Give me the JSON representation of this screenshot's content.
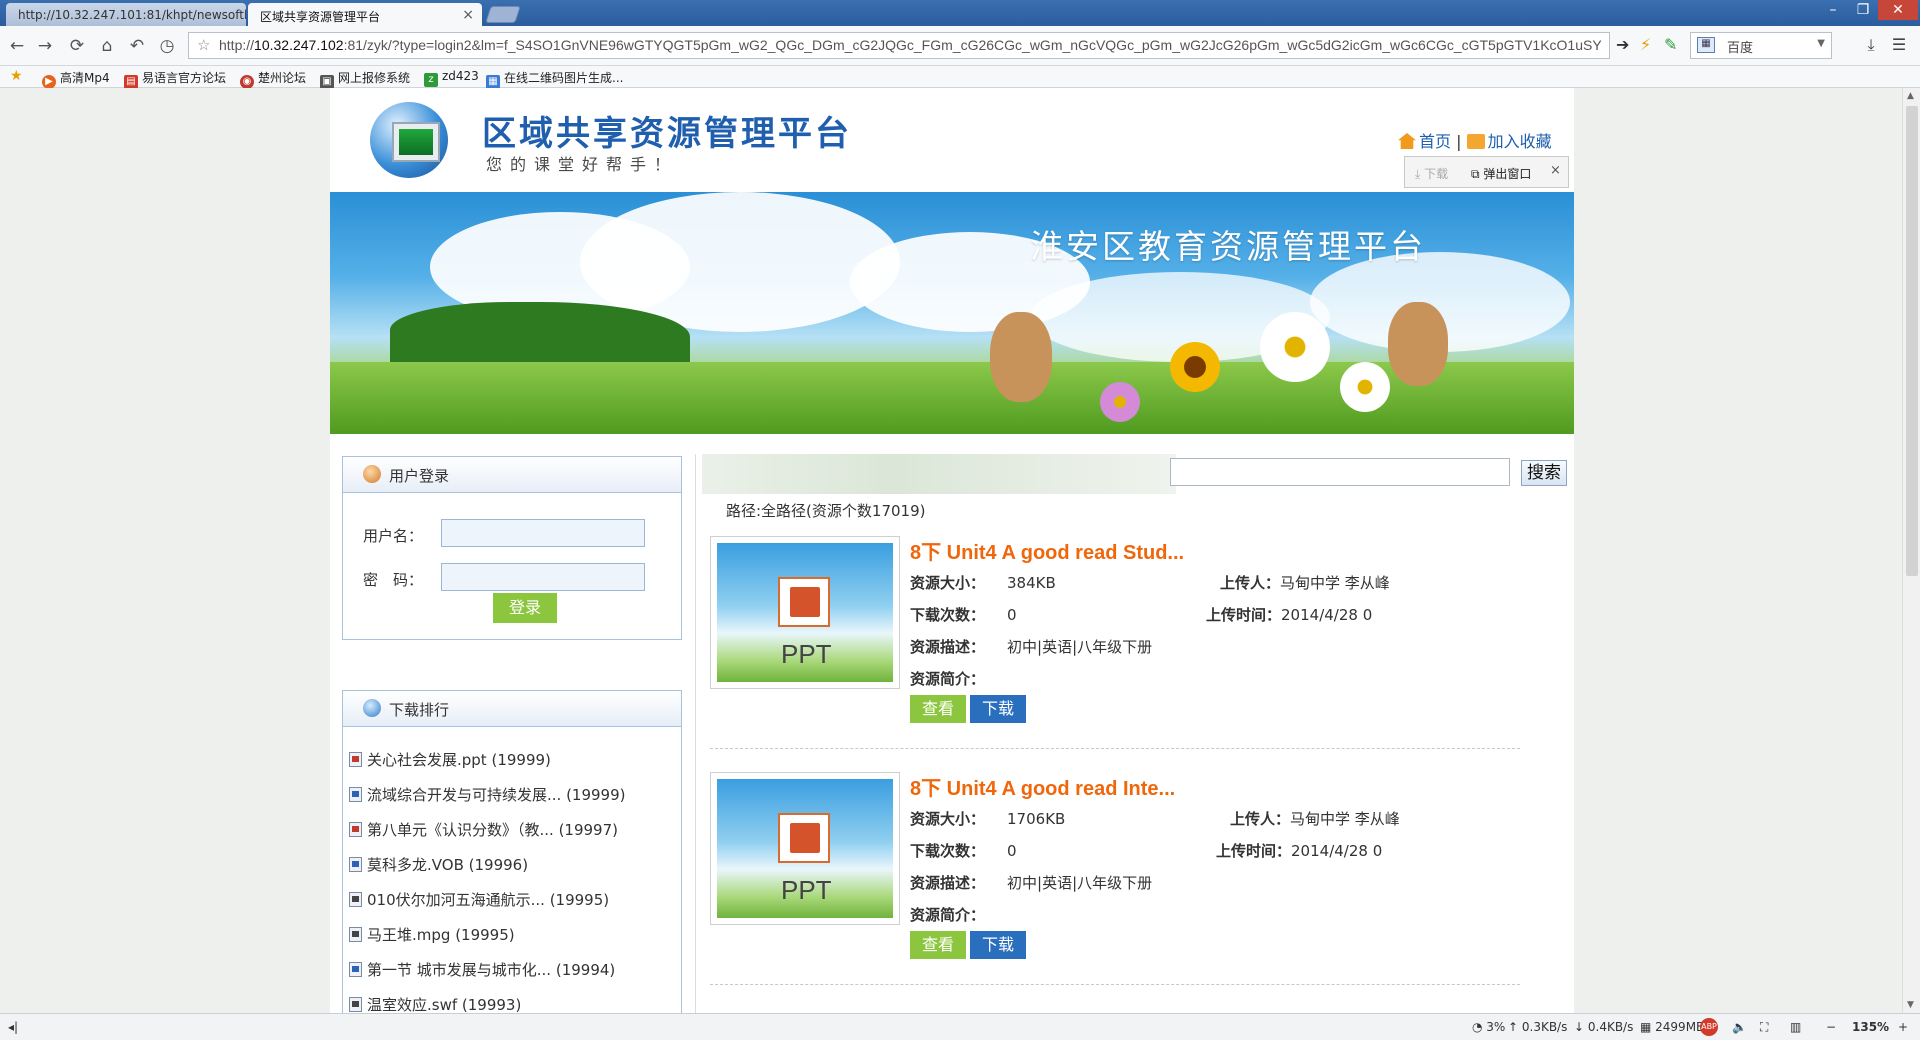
{
  "browser": {
    "tabs": [
      {
        "title": "http://10.32.247.101:81/khpt/newsoftli..."
      },
      {
        "title": "区域共享资源管理平台"
      }
    ],
    "address_prefix": "http://",
    "address_host": "10.32.247.102",
    "address_rest": ":81/zyk/?type=login2&lm=f_S4SO1GnVNE96wGTYQGT5pGm_wG2_QGc_DGm_cG2JQGc_FGm_cG26CGc_wGm_nGcVQGc_pGm_wG2JcG26pGm_wGc5dG2icGm_wGc6CGc_cGT5pGTV1KcO1uSY",
    "search_engine": "百度",
    "bookmarks": [
      "高清Mp4",
      "易语言官方论坛",
      "楚州论坛",
      "网上报修系统",
      "zd423",
      "在线二维码图片生成..."
    ],
    "status": {
      "cpu": "3%",
      "upload": "0.3KB/s",
      "download": "0.4KB/s",
      "memory": "2499MB",
      "zoom": "135%"
    }
  },
  "header": {
    "title": "区域共享资源管理平台",
    "slogan": "您的课堂好帮手！",
    "home_link": "首页",
    "separator": "|",
    "favorite_link": "加入收藏",
    "float_download": "下载",
    "float_popup": "弹出窗口",
    "float_close": "×"
  },
  "banner": {
    "title": "淮安区教育资源管理平台"
  },
  "login": {
    "heading": "用户登录",
    "username_label": "用户名：",
    "password_label": "密　码：",
    "submit": "登录"
  },
  "ranking": {
    "heading": "下载排行",
    "items": [
      {
        "name": "关心社会发展.ppt (19999)",
        "kind": "ppt"
      },
      {
        "name": "流域综合开发与可持续发展... (19999)",
        "kind": "doc"
      },
      {
        "name": "第八单元《认识分数》（教... (19997)",
        "kind": "ppt"
      },
      {
        "name": "莫科多龙.VOB (19996)",
        "kind": "doc"
      },
      {
        "name": "010伏尔加河五海通航示... (19995)",
        "kind": "swf"
      },
      {
        "name": "马王堆.mpg (19995)",
        "kind": "vid"
      },
      {
        "name": "第一节 城市发展与城市化... (19994)",
        "kind": "doc"
      },
      {
        "name": "温室效应.swf (19993)",
        "kind": "swf"
      }
    ]
  },
  "main": {
    "search_button": "搜索",
    "path": "路径:全路径(资源个数17019)",
    "thumb_label": "PPT",
    "labels": {
      "size": "资源大小：",
      "downloads": "下载次数：",
      "desc": "资源描述：",
      "intro": "资源简介：",
      "uploader": "上传人：",
      "upload_time": "上传时间："
    },
    "view_button": "查看",
    "download_button": "下载",
    "resources": [
      {
        "title": "8下 Unit4 A good read Stud...",
        "size": "384KB",
        "downloads": "0",
        "desc": "初中|英语|八年级下册",
        "intro": "",
        "uploader": "马甸中学 李从峰",
        "upload_time": "2014/4/28 0"
      },
      {
        "title": "8下 Unit4 A good read Inte...",
        "size": "1706KB",
        "downloads": "0",
        "desc": "初中|英语|八年级下册",
        "intro": "",
        "uploader": "马甸中学 李从峰",
        "upload_time": "2014/4/28 0"
      }
    ]
  }
}
